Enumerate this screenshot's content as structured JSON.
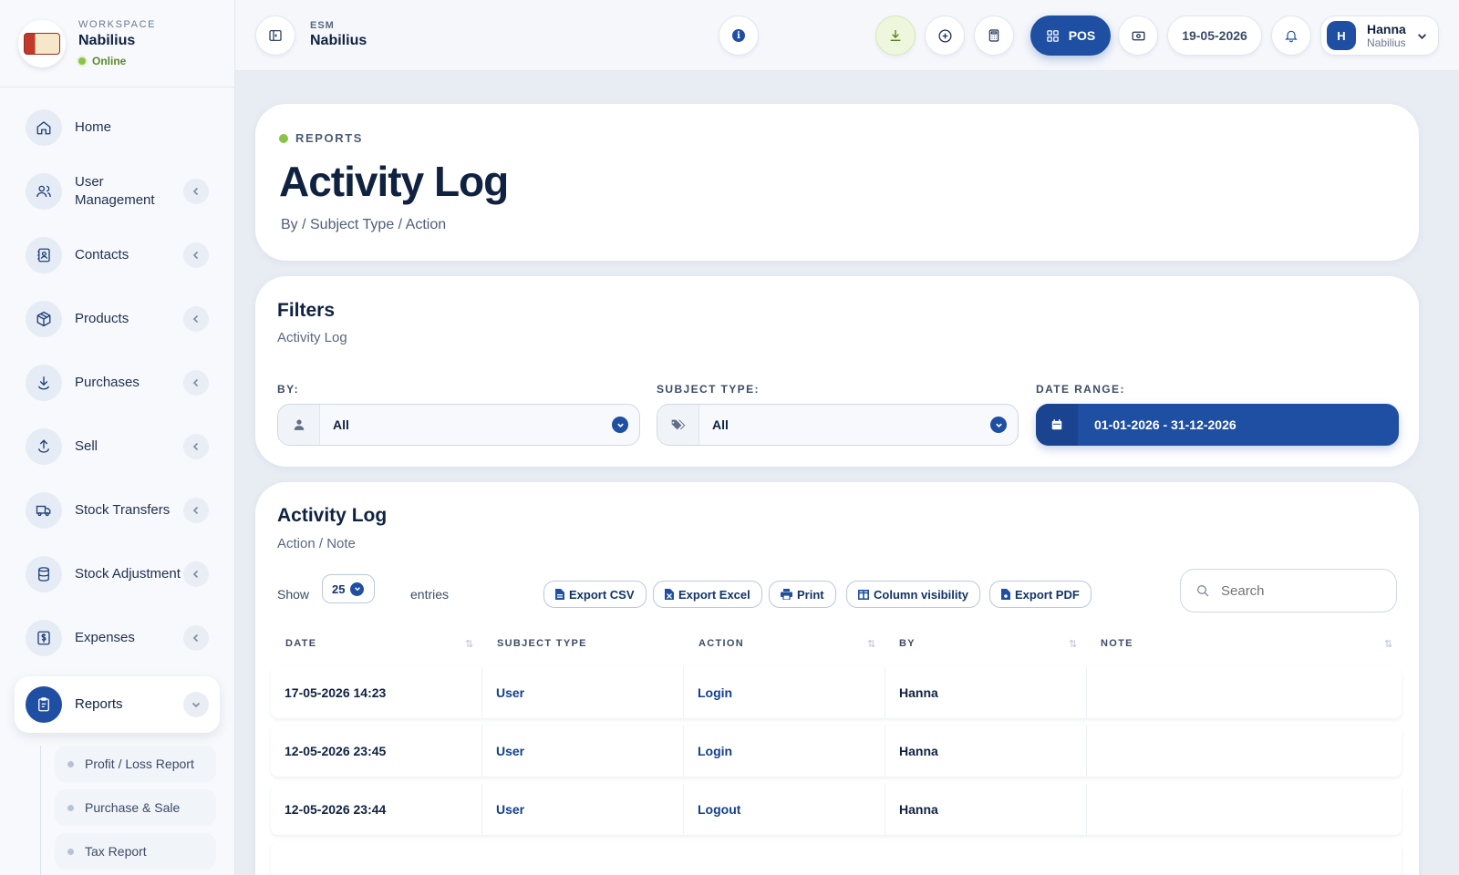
{
  "workspace": {
    "kicker": "WORKSPACE",
    "name": "Nabilius",
    "status": "Online"
  },
  "sidebar": {
    "items": [
      {
        "label": "Home",
        "icon": "home-icon"
      },
      {
        "label": "User Management",
        "icon": "users-icon"
      },
      {
        "label": "Contacts",
        "icon": "contacts-icon"
      },
      {
        "label": "Products",
        "icon": "box-icon"
      },
      {
        "label": "Purchases",
        "icon": "download-icon"
      },
      {
        "label": "Sell",
        "icon": "upload-icon"
      },
      {
        "label": "Stock Transfers",
        "icon": "truck-icon"
      },
      {
        "label": "Stock Adjustment",
        "icon": "database-icon"
      },
      {
        "label": "Expenses",
        "icon": "dollar-icon"
      },
      {
        "label": "Reports",
        "icon": "clipboard-icon"
      }
    ],
    "reports_sub": [
      "Profit / Loss Report",
      "Purchase & Sale",
      "Tax Report"
    ]
  },
  "topbar": {
    "kicker": "ESM",
    "title": "Nabilius",
    "pos_label": "POS",
    "date": "19-05-2026",
    "user_initial": "H",
    "user_name": "Hanna",
    "user_org": "Nabilius"
  },
  "header": {
    "kicker": "REPORTS",
    "title": "Activity Log",
    "breadcrumb": "By / Subject Type / Action"
  },
  "filters": {
    "title": "Filters",
    "subtitle": "Activity Log",
    "by_label": "BY:",
    "by_value": "All",
    "subject_label": "SUBJECT TYPE:",
    "subject_value": "All",
    "date_label": "DATE RANGE:",
    "date_value": "01-01-2026 - 31-12-2026"
  },
  "log": {
    "title": "Activity Log",
    "subtitle": "Action / Note",
    "show_label": "Show",
    "entries_value": "25",
    "entries_label": "entries",
    "buttons": [
      "Export CSV",
      "Export Excel",
      "Print",
      "Column visibility",
      "Export PDF"
    ],
    "search_placeholder": "Search",
    "columns": [
      "DATE",
      "SUBJECT TYPE",
      "ACTION",
      "BY",
      "NOTE"
    ],
    "rows": [
      {
        "date": "17-05-2026 14:23",
        "subject": "User",
        "action": "Login",
        "by": "Hanna",
        "note": ""
      },
      {
        "date": "12-05-2026 23:45",
        "subject": "User",
        "action": "Login",
        "by": "Hanna",
        "note": ""
      },
      {
        "date": "12-05-2026 23:44",
        "subject": "User",
        "action": "Logout",
        "by": "Hanna",
        "note": ""
      }
    ]
  },
  "colors": {
    "accent": "#1f4fa3",
    "online": "#8bc34a",
    "download_bg": "#eef6dd"
  }
}
